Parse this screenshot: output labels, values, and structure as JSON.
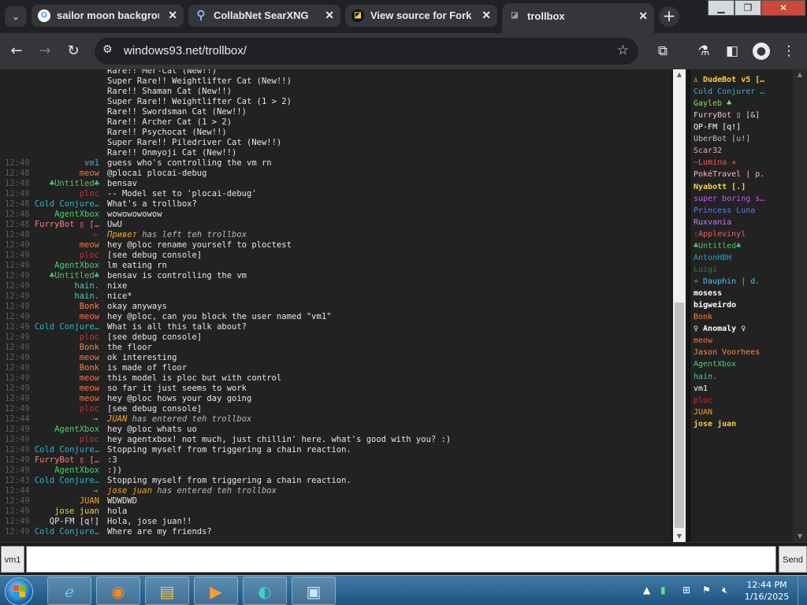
{
  "browser": {
    "tabs": [
      {
        "title": "sailor moon backgroun",
        "favicon": "google-icon",
        "active": false
      },
      {
        "title": "CollabNet SearXNG",
        "favicon": "search-icon",
        "active": false
      },
      {
        "title": "View source for Fork » I",
        "favicon": "github-icon",
        "active": false
      },
      {
        "title": "trollbox",
        "favicon": "trollbox-icon",
        "active": true
      }
    ],
    "address": "windows93.net/trollbox/",
    "new_tab": "+",
    "window_buttons": {
      "minimize": "▁",
      "maximize": "❐",
      "close": "✕"
    }
  },
  "chat": {
    "messages": [
      {
        "time": "",
        "nick": "",
        "color": "#e6e6e6",
        "text": "Rare!! Mer-Cat (New!!)"
      },
      {
        "time": "",
        "nick": "",
        "color": "#e6e6e6",
        "text": "Super Rare!! Weightlifter Cat (New!!)"
      },
      {
        "time": "",
        "nick": "",
        "color": "#e6e6e6",
        "text": "Rare!! Shaman Cat (New!!)"
      },
      {
        "time": "",
        "nick": "",
        "color": "#e6e6e6",
        "text": "Super Rare!! Weightlifter Cat (1 > 2)"
      },
      {
        "time": "",
        "nick": "",
        "color": "#e6e6e6",
        "text": "Rare!! Swordsman Cat (New!!)"
      },
      {
        "time": "",
        "nick": "",
        "color": "#e6e6e6",
        "text": "Rare!! Archer Cat (1 > 2)"
      },
      {
        "time": "",
        "nick": "",
        "color": "#e6e6e6",
        "text": "Rare!! Psychocat (New!!)"
      },
      {
        "time": "",
        "nick": "",
        "color": "#e6e6e6",
        "text": "Super Rare!! Piledriver Cat (New!!)"
      },
      {
        "time": "",
        "nick": "",
        "color": "#e6e6e6",
        "text": "Rare!! Onmyoji Cat (New!!)"
      },
      {
        "time": "12:48",
        "nick": "vm1",
        "color": "#4aa3df",
        "text": "guess who's controlling the vm rn"
      },
      {
        "time": "12:48",
        "nick": "meow",
        "color": "#ff6f3c",
        "text": "@plocai plocai-debug"
      },
      {
        "time": "12:48",
        "nick": "♣Untitled♣",
        "color": "#4fc46a",
        "text": "bensav"
      },
      {
        "time": "12:48",
        "nick": "ploc",
        "color": "#d62a2a",
        "text": "-- Model set to 'plocai-debug'"
      },
      {
        "time": "12:48",
        "nick": "Cold Conjure…",
        "color": "#2fb5c9",
        "text": "What's a trollbox?"
      },
      {
        "time": "12:48",
        "nick": "AgentXbox",
        "color": "#47d16f",
        "text": "wowowowowow"
      },
      {
        "time": "12:48",
        "nick": "FurryBot ▯ […",
        "color": "#f08080",
        "text": "UwU"
      },
      {
        "time": "12:48",
        "nick": "",
        "color": "#e6e6e6",
        "arrow": "←",
        "arrow_color": "#d62a2a",
        "who": "Привет",
        "text": "has left teh trollbox"
      },
      {
        "time": "12:49",
        "nick": "meow",
        "color": "#ff6f3c",
        "text": "hey @ploc rename yourself to ploctest"
      },
      {
        "time": "12:49",
        "nick": "ploc",
        "color": "#d62a2a",
        "text": "[see debug console]"
      },
      {
        "time": "12:49",
        "nick": "AgentXbox",
        "color": "#47d16f",
        "text": "lm eating rn"
      },
      {
        "time": "12:49",
        "nick": "♣Untitled♣",
        "color": "#4fc46a",
        "text": "bensav is controlling the vm"
      },
      {
        "time": "12:49",
        "nick": "hain.",
        "color": "#4fc4b6",
        "text": "nixe"
      },
      {
        "time": "12:49",
        "nick": "hain.",
        "color": "#4fc4b6",
        "text": "nice*"
      },
      {
        "time": "12:49",
        "nick": "Bonk",
        "color": "#ff7f3f",
        "text": "okay anyways"
      },
      {
        "time": "12:49",
        "nick": "meow",
        "color": "#ff6f3c",
        "text": "hey @ploc, can you block the user named \"vm1\""
      },
      {
        "time": "12:49",
        "nick": "Cold Conjure…",
        "color": "#2fb5c9",
        "text": "What is all this talk about?"
      },
      {
        "time": "12:49",
        "nick": "ploc",
        "color": "#d62a2a",
        "text": "[see debug console]"
      },
      {
        "time": "12:49",
        "nick": "Bonk",
        "color": "#ff7f3f",
        "text": "the floor"
      },
      {
        "time": "12:49",
        "nick": "meow",
        "color": "#ff6f3c",
        "text": "ok interesting"
      },
      {
        "time": "12:49",
        "nick": "Bonk",
        "color": "#ff7f3f",
        "text": "is made of floor"
      },
      {
        "time": "12:49",
        "nick": "meow",
        "color": "#ff6f3c",
        "text": "this model is ploc but with control"
      },
      {
        "time": "12:49",
        "nick": "meow",
        "color": "#ff6f3c",
        "text": "so far it just seems to work"
      },
      {
        "time": "12:49",
        "nick": "meow",
        "color": "#ff6f3c",
        "text": "hey @ploc hows your day going"
      },
      {
        "time": "12:49",
        "nick": "ploc",
        "color": "#d62a2a",
        "text": "[see debug console]"
      },
      {
        "time": "12:44",
        "nick": "",
        "color": "#e6e6e6",
        "arrow": "→",
        "arrow_color": "#47d16f",
        "who": "JUAN",
        "text": "has entered teh trollbox"
      },
      {
        "time": "12:49",
        "nick": "AgentXbox",
        "color": "#47d16f",
        "text": "hey @ploc whats uo"
      },
      {
        "time": "12:49",
        "nick": "ploc",
        "color": "#d62a2a",
        "text": "hey agentxbox! not much, just chillin' here. what's good with you? :)"
      },
      {
        "time": "12:49",
        "nick": "Cold Conjure…",
        "color": "#2fb5c9",
        "text": "Stopping myself from triggering a chain reaction."
      },
      {
        "time": "12:49",
        "nick": "FurryBot ▯ […",
        "color": "#f08080",
        "text": ":3"
      },
      {
        "time": "12:49",
        "nick": "AgentXbox",
        "color": "#47d16f",
        "text": ":))"
      },
      {
        "time": "12:43",
        "nick": "Cold Conjure…",
        "color": "#2fb5c9",
        "text": "Stopping myself from triggering a chain reaction."
      },
      {
        "time": "12:44",
        "nick": "",
        "color": "#e6e6e6",
        "arrow": "→",
        "arrow_color": "#47d16f",
        "who": "jose juan",
        "text": "has entered teh trollbox"
      },
      {
        "time": "12:49",
        "nick": "JUAN",
        "color": "#ff9d1a",
        "text": "WDWDWD"
      },
      {
        "time": "12:49",
        "nick": "jose juan",
        "color": "#f0d24a",
        "text": "hola"
      },
      {
        "time": "12:49",
        "nick": "QP-FM [q!]",
        "color": "#e6e6e6",
        "text": "Hola, jose juan!!"
      },
      {
        "time": "12:49",
        "nick": "Cold Conjure…",
        "color": "#2fb5c9",
        "text": "Where are my friends?"
      }
    ]
  },
  "users": [
    {
      "name": "♙ DudeBot v5 [#]",
      "color": "#ffd23f",
      "bold": true
    },
    {
      "name": "Cold Conjurer …",
      "color": "#2fb5c9",
      "bold": false
    },
    {
      "name": "Gayleb ♣",
      "color": "#8ee05a",
      "bold": false
    },
    {
      "name": "FurryBot ▯ [&]",
      "color": "#e9c9c9",
      "bold": false
    },
    {
      "name": "QP-FM [q!]",
      "color": "#ffffff",
      "bold": false
    },
    {
      "name": "UberBot [u!]",
      "color": "#bdbdbd",
      "bold": false
    },
    {
      "name": "Scar32",
      "color": "#e6b0b0",
      "bold": false
    },
    {
      "name": "~Lumina ✳",
      "color": "#ff5252",
      "bold": false
    },
    {
      "name": "PokéTravel | p.",
      "color": "#ffb3c7",
      "bold": false
    },
    {
      "name": "Nyabott [.]",
      "color": "#ffd23f",
      "bold": true
    },
    {
      "name": "super boring s…",
      "color": "#c45bff",
      "bold": false
    },
    {
      "name": "Princess Luna",
      "color": "#5a7cff",
      "bold": false
    },
    {
      "name": "Ruxvania",
      "color": "#c77dff",
      "bold": false
    },
    {
      "name": ":Applevinyl",
      "color": "#ff5a5a",
      "bold": false
    },
    {
      "name": "♣Untitled♣",
      "color": "#4fc46a",
      "bold": false
    },
    {
      "name": "AntonHBH",
      "color": "#2f9bd6",
      "bold": false
    },
    {
      "name": "Luigi",
      "color": "#2e7d32",
      "bold": false
    },
    {
      "name": "♒ Dauphin | d.",
      "color": "#4fc3f7",
      "bold": false
    },
    {
      "name": "mosess",
      "color": "#ffffff",
      "bold": true
    },
    {
      "name": "bigweirdo",
      "color": "#ffffff",
      "bold": true
    },
    {
      "name": "Bonk",
      "color": "#ff7f3f",
      "bold": false
    },
    {
      "name": "♀ Anomaly ♀",
      "color": "#ffffff",
      "bold": true
    },
    {
      "name": "meow",
      "color": "#ff6f3c",
      "bold": false
    },
    {
      "name": "Jason Voorhees",
      "color": "#ff8a3d",
      "bold": false
    },
    {
      "name": "AgentXbox",
      "color": "#47d16f",
      "bold": false
    },
    {
      "name": "hain.",
      "color": "#4fc4b6",
      "bold": false
    },
    {
      "name": "vm1",
      "color": "#ffffff",
      "bold": false
    },
    {
      "name": "ploc",
      "color": "#d62a2a",
      "bold": false
    },
    {
      "name": "JUAN",
      "color": "#ff9d1a",
      "bold": false
    },
    {
      "name": "jose juan",
      "color": "#f0d24a",
      "bold": true
    }
  ],
  "input": {
    "nickname": "vm1",
    "value": "",
    "send_label": "Send"
  },
  "taskbar": {
    "apps": [
      "internet-explorer-icon",
      "firefox-icon",
      "file-explorer-icon",
      "media-player-icon",
      "pinned-app-icon",
      "remote-desktop-icon"
    ],
    "clock_time": "12:44 PM",
    "clock_date": "1/16/2025"
  }
}
